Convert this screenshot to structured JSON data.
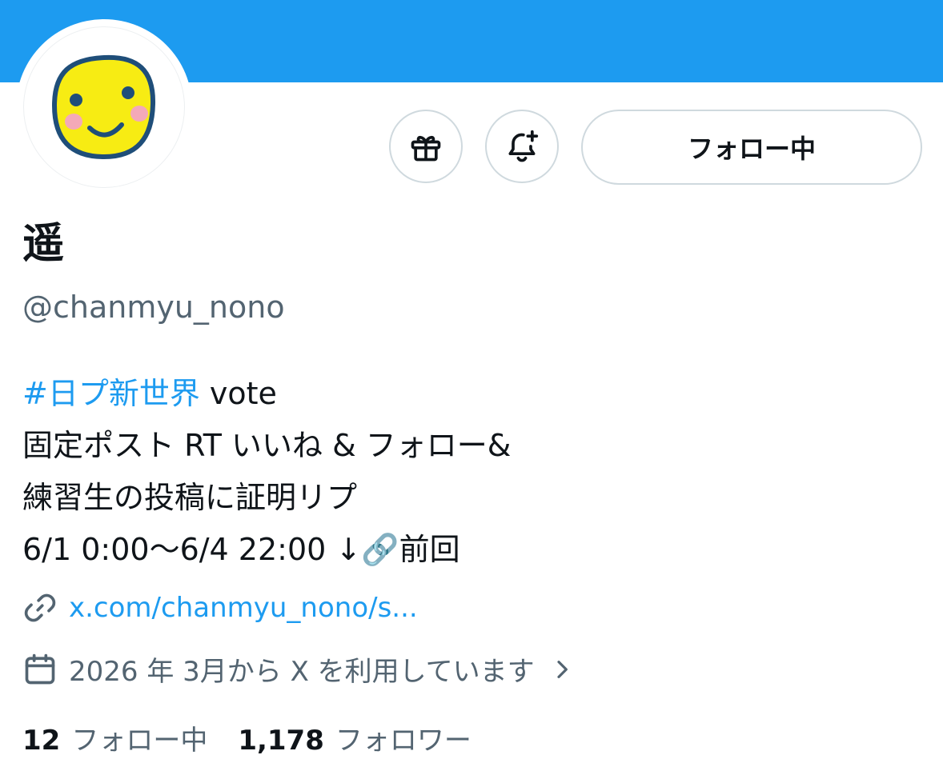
{
  "profile": {
    "display_name": "遥",
    "handle": "@chanmyu_nono"
  },
  "actions": {
    "follow_label": "フォロー中"
  },
  "bio": {
    "hashtag": "#日プ新世界",
    "line1_rest": " vote",
    "line2": "固定ポスト RT いいね & フォロー&",
    "line3": "練習生の投稿に証明リプ",
    "line4_text": "6/1 0:00～6/4 22:00 ↓",
    "line4_emoji": "🔗",
    "line4_end": "前回"
  },
  "meta": {
    "link": "x.com/chanmyu_nono/s...",
    "joined": "2026 年 3月から X を利用しています"
  },
  "stats": {
    "following_count": "12",
    "following_label": "フォロー中",
    "followers_count": "1,178",
    "followers_label": "フォロワー"
  },
  "colors": {
    "banner": "#1d9bf0",
    "link": "#1d9bf0",
    "avatar_face": "#f7ec13",
    "avatar_outline": "#1f4e79",
    "avatar_cheek": "#f4a9b8"
  },
  "icons": [
    "gift-icon",
    "bell-plus-icon",
    "link-icon",
    "calendar-icon",
    "chevron-right-icon"
  ]
}
